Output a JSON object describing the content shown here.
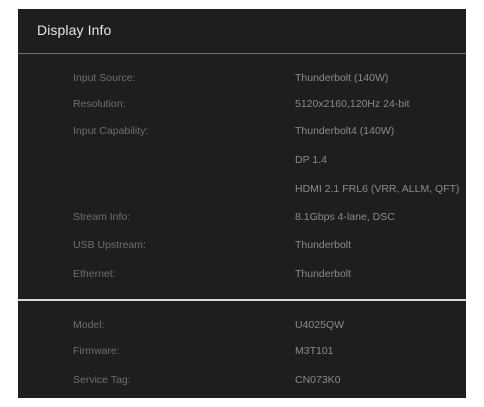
{
  "panel": {
    "title": "Display Info"
  },
  "info_rows": [
    {
      "label": "Input Source:",
      "value": "Thunderbolt (140W)"
    },
    {
      "label": "Resolution:",
      "value": "5120x2160,120Hz 24-bit"
    },
    {
      "label": "Input Capability:",
      "value": "Thunderbolt4 (140W)"
    },
    {
      "label": "",
      "value": "DP 1.4"
    },
    {
      "label": "",
      "value": "HDMI 2.1 FRL6 (VRR, ALLM, QFT)"
    },
    {
      "label": "Stream Info:",
      "value": "8.1Gbps 4-lane, DSC"
    },
    {
      "label": "USB Upstream:",
      "value": "Thunderbolt"
    },
    {
      "label": "Ethernet:",
      "value": "Thunderbolt"
    }
  ],
  "device_rows": [
    {
      "label": "Model:",
      "value": "U4025QW"
    },
    {
      "label": "Firmware:",
      "value": "M3T101"
    },
    {
      "label": "Service Tag:",
      "value": "CN073K0"
    }
  ],
  "colors": {
    "panel_background": "#1e1e1e",
    "title_text": "#e6e6e6",
    "label_text": "#6e6e6e",
    "value_text": "#8a8a8a",
    "divider": "#d8d8d8"
  }
}
